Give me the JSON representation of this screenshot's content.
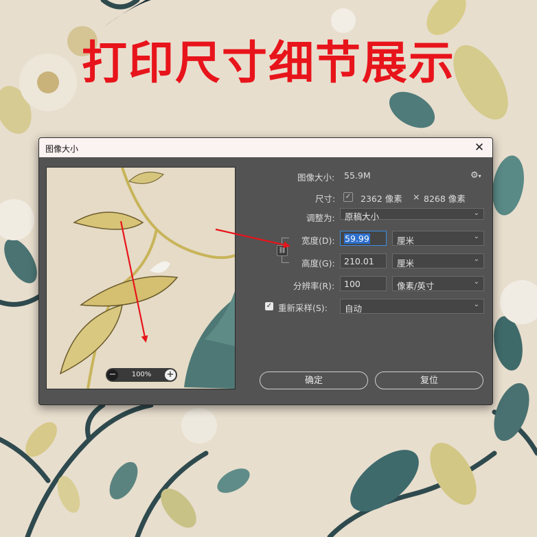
{
  "headline": "打印尺寸细节展示",
  "dialog": {
    "title": "图像大小",
    "close_glyph": "✕",
    "image_size_label": "图像大小:",
    "image_size_value": "55.9M",
    "settings_glyph": "⚙",
    "dimensions_label": "尺寸:",
    "dimensions_width": "2362 像素",
    "dimensions_times": "×",
    "dimensions_height": "8268 像素",
    "fit_to_label": "调整为:",
    "fit_to_value": "原稿大小",
    "width_label": "宽度(D):",
    "width_value": "59.99",
    "width_unit": "厘米",
    "height_label": "高度(G):",
    "height_value": "210.01",
    "height_unit": "厘米",
    "resolution_label": "分辨率(R):",
    "resolution_value": "100",
    "resolution_unit": "像素/英寸",
    "resample_label": "重新采样(S):",
    "resample_checked": true,
    "resample_value": "自动",
    "zoom_value": "100%",
    "zoom_minus": "−",
    "zoom_plus": "+",
    "ok_label": "确定",
    "reset_label": "复位"
  },
  "colors": {
    "headline": "#e8141b",
    "dialog_bg": "#535353",
    "titlebar_bg": "#fbf3f1",
    "arrow": "#e8141b",
    "input_focus": "#3a8ee6"
  }
}
